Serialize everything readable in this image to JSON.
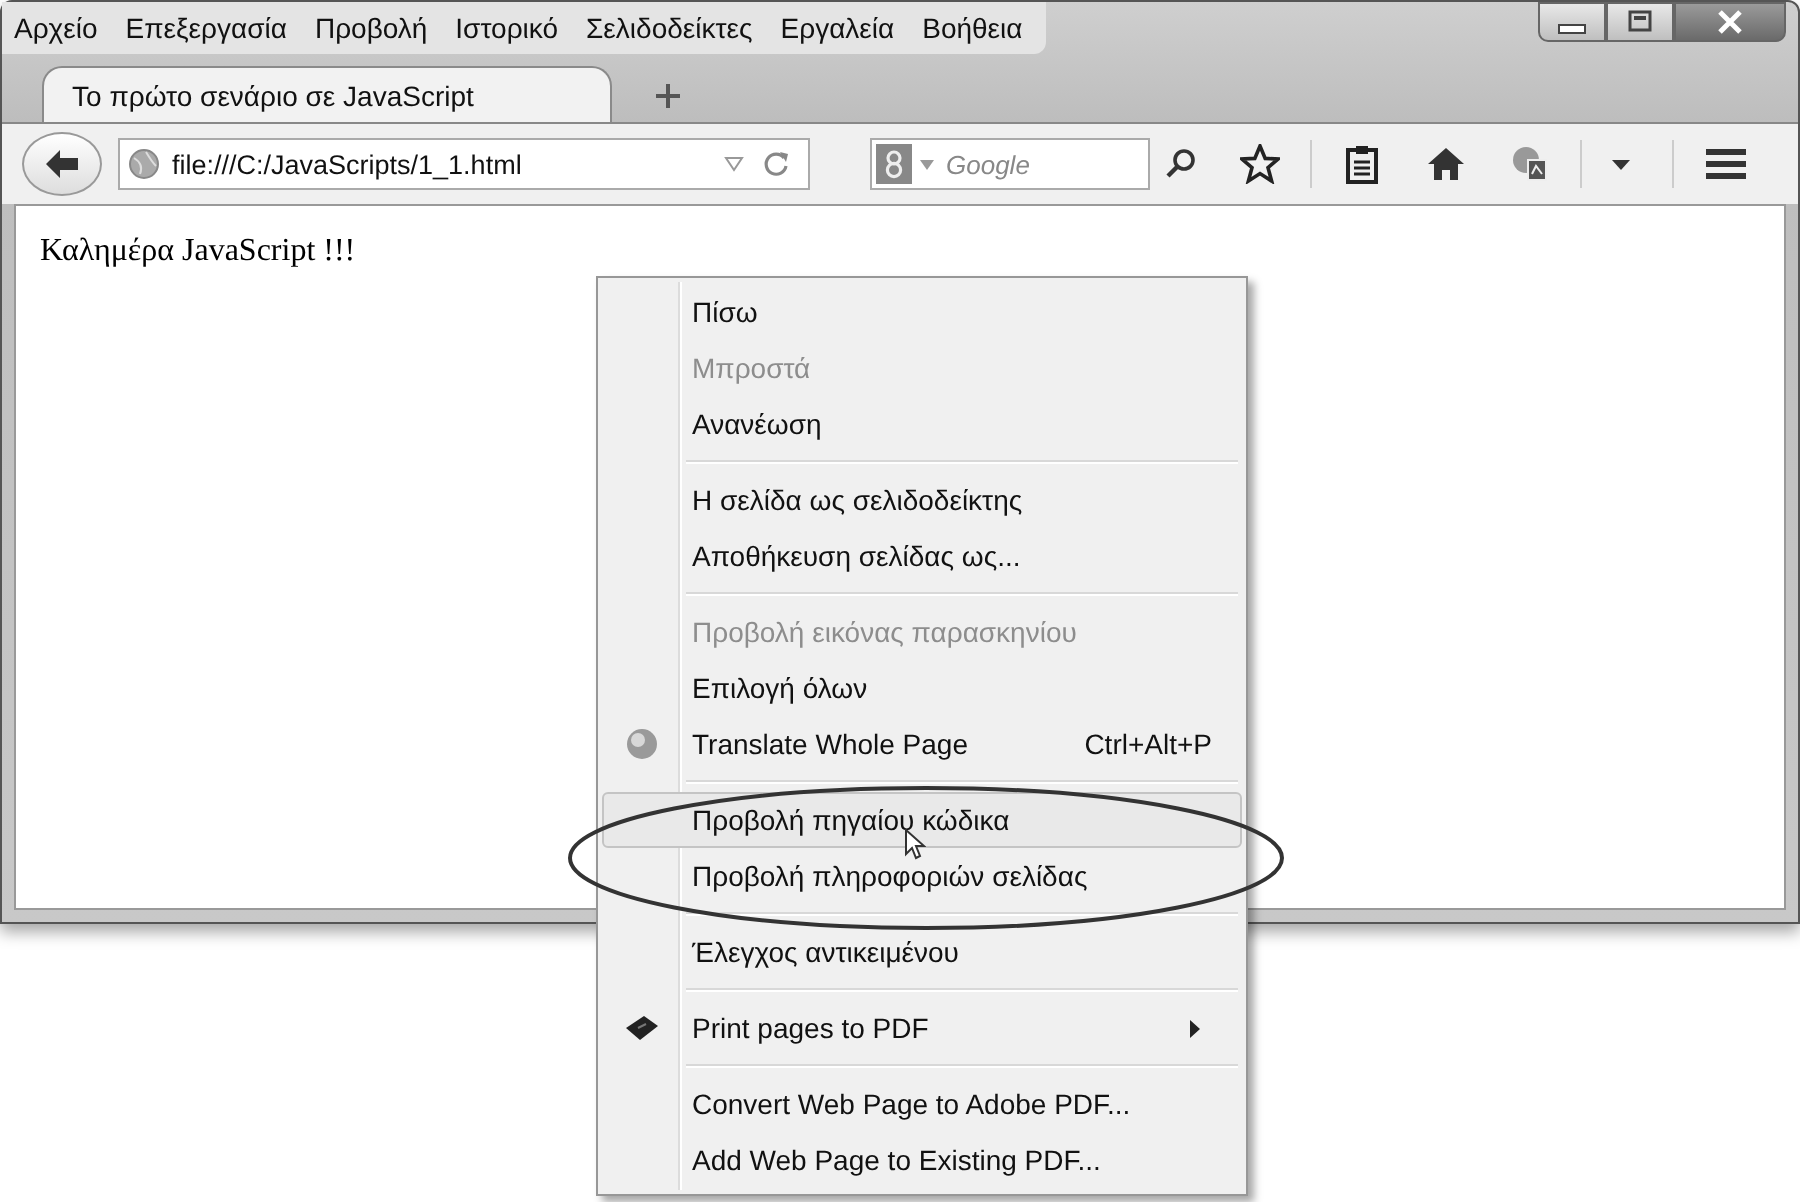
{
  "menu_bar": [
    {
      "label": "Αρχείο"
    },
    {
      "label": "Επεξεργασία"
    },
    {
      "label": "Προβολή"
    },
    {
      "label": "Ιστορικό"
    },
    {
      "label": "Σελιδοδείκτες"
    },
    {
      "label": "Εργαλεία"
    },
    {
      "label": "Βοήθεια"
    }
  ],
  "tabs": [
    {
      "label": "Το πρώτο σενάριο σε JavaScript",
      "selected": true
    }
  ],
  "address_bar": {
    "value": "file:///C:/JavaScripts/1_1.html"
  },
  "search": {
    "placeholder": "Google"
  },
  "page": {
    "text": "Καλημέρα JavaScript !!!"
  },
  "context_menu": {
    "items": [
      {
        "kind": "item",
        "label": "Πίσω",
        "disabled": false,
        "selected": false
      },
      {
        "kind": "item",
        "label": "Μπροστά",
        "disabled": true,
        "selected": false
      },
      {
        "kind": "item",
        "label": "Ανανέωση",
        "disabled": false,
        "selected": false
      },
      {
        "kind": "separator"
      },
      {
        "kind": "item",
        "label": "Η σελίδα ως σελιδοδείκτης",
        "disabled": false,
        "selected": false
      },
      {
        "kind": "item",
        "label": "Αποθήκευση σελίδας ως...",
        "disabled": false,
        "selected": false
      },
      {
        "kind": "separator"
      },
      {
        "kind": "item",
        "label": "Προβολή εικόνας παρασκηνίου",
        "disabled": true,
        "selected": false
      },
      {
        "kind": "item",
        "label": "Επιλογή όλων",
        "disabled": false,
        "selected": false
      },
      {
        "kind": "item",
        "label": "Translate Whole Page",
        "shortcut": "Ctrl+Alt+P",
        "disabled": false,
        "selected": false
      },
      {
        "kind": "separator"
      },
      {
        "kind": "item",
        "label": "Προβολή πηγαίου κώδικα",
        "disabled": false,
        "selected": true
      },
      {
        "kind": "item",
        "label": "Προβολή πληροφοριών σελίδας",
        "disabled": false,
        "selected": false
      },
      {
        "kind": "separator"
      },
      {
        "kind": "item",
        "label": "Έλεγχος αντικειμένου",
        "disabled": false,
        "selected": false
      },
      {
        "kind": "separator"
      },
      {
        "kind": "submenu",
        "label": "Print pages to PDF",
        "disabled": false,
        "selected": false
      },
      {
        "kind": "separator"
      },
      {
        "kind": "item",
        "label": "Convert Web Page to Adobe PDF...",
        "disabled": false,
        "selected": false
      },
      {
        "kind": "item",
        "label": "Add Web Page to Existing PDF...",
        "disabled": false,
        "selected": false
      }
    ]
  }
}
